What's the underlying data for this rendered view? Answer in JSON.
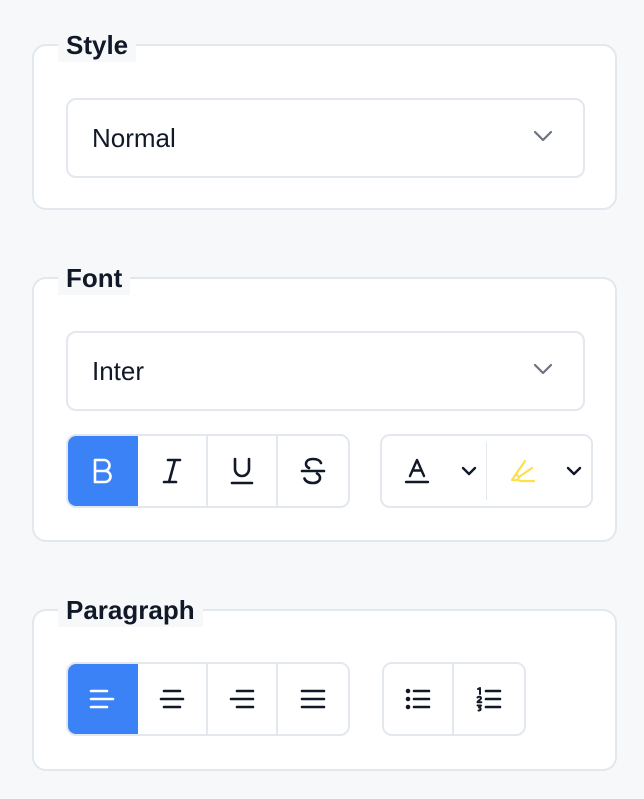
{
  "style_group": {
    "legend": "Style",
    "select_value": "Normal",
    "chevron_icon": "chevron-down-icon"
  },
  "font_group": {
    "legend": "Font",
    "select_value": "Inter",
    "chevron_icon": "chevron-down-icon",
    "format_buttons": [
      {
        "icon": "bold-icon",
        "active": true
      },
      {
        "icon": "italic-icon",
        "active": false
      },
      {
        "icon": "underline-icon",
        "active": false
      },
      {
        "icon": "strikethrough-icon",
        "active": false
      }
    ],
    "color_buttons": [
      {
        "icon": "text-color-icon",
        "color": "#111827"
      },
      {
        "icon": "highlight-color-icon",
        "color": "#fde047"
      }
    ]
  },
  "paragraph_group": {
    "legend": "Paragraph",
    "align_buttons": [
      {
        "icon": "align-left-icon",
        "active": true
      },
      {
        "icon": "align-center-icon",
        "active": false
      },
      {
        "icon": "align-right-icon",
        "active": false
      },
      {
        "icon": "align-justify-icon",
        "active": false
      }
    ],
    "list_buttons": [
      {
        "icon": "bullet-list-icon"
      },
      {
        "icon": "numbered-list-icon"
      }
    ]
  },
  "colors": {
    "accent": "#3b82f6",
    "border": "#e3e7ee",
    "background": "#f7f8fa",
    "highlight": "#fde047",
    "text": "#111827"
  }
}
